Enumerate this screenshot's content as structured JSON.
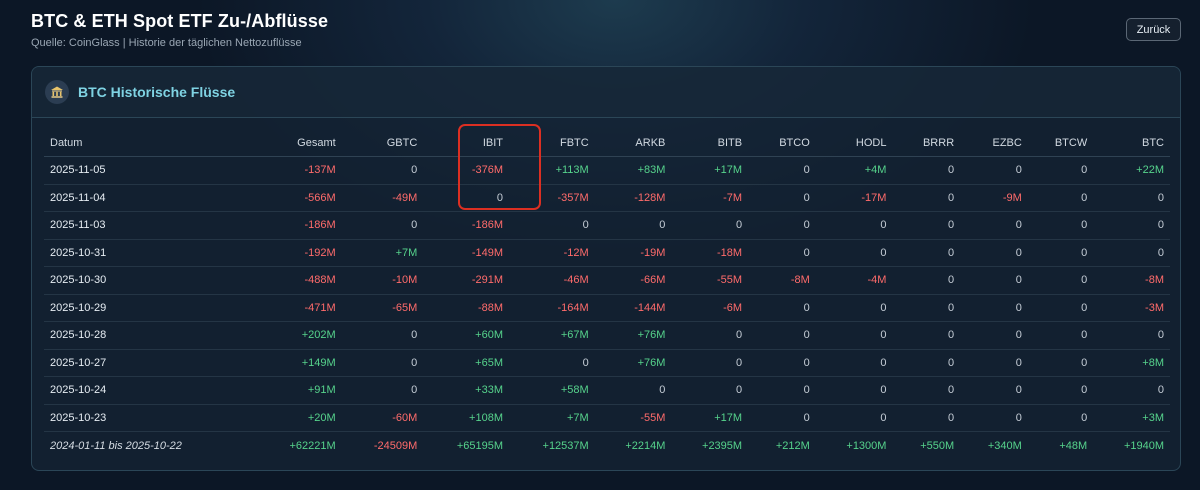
{
  "page": {
    "title": "BTC & ETH Spot ETF Zu-/Abflüsse",
    "subtitle": "Quelle: CoinGlass | Historie der täglichen Nettozuflüsse",
    "back_label": "Zurück"
  },
  "card": {
    "title": "BTC Historische Flüsse",
    "icon": "bank-icon"
  },
  "colors": {
    "positive": "#56d38c",
    "negative": "#ff6b6b",
    "accent": "#7fd3e3",
    "highlight": "#dc2f22"
  },
  "table": {
    "headers": [
      "Datum",
      "Gesamt",
      "GBTC",
      "IBIT",
      "FBTC",
      "ARKB",
      "BITB",
      "BTCO",
      "HODL",
      "BRRR",
      "EZBC",
      "BTCW",
      "BTC"
    ],
    "rows": [
      [
        "2025-11-05",
        "-137M",
        "0",
        "-376M",
        "+113M",
        "+83M",
        "+17M",
        "0",
        "+4M",
        "0",
        "0",
        "0",
        "+22M"
      ],
      [
        "2025-11-04",
        "-566M",
        "-49M",
        "0",
        "-357M",
        "-128M",
        "-7M",
        "0",
        "-17M",
        "0",
        "-9M",
        "0",
        "0"
      ],
      [
        "2025-11-03",
        "-186M",
        "0",
        "-186M",
        "0",
        "0",
        "0",
        "0",
        "0",
        "0",
        "0",
        "0",
        "0"
      ],
      [
        "2025-10-31",
        "-192M",
        "+7M",
        "-149M",
        "-12M",
        "-19M",
        "-18M",
        "0",
        "0",
        "0",
        "0",
        "0",
        "0"
      ],
      [
        "2025-10-30",
        "-488M",
        "-10M",
        "-291M",
        "-46M",
        "-66M",
        "-55M",
        "-8M",
        "-4M",
        "0",
        "0",
        "0",
        "-8M"
      ],
      [
        "2025-10-29",
        "-471M",
        "-65M",
        "-88M",
        "-164M",
        "-144M",
        "-6M",
        "0",
        "0",
        "0",
        "0",
        "0",
        "-3M"
      ],
      [
        "2025-10-28",
        "+202M",
        "0",
        "+60M",
        "+67M",
        "+76M",
        "0",
        "0",
        "0",
        "0",
        "0",
        "0",
        "0"
      ],
      [
        "2025-10-27",
        "+149M",
        "0",
        "+65M",
        "0",
        "+76M",
        "0",
        "0",
        "0",
        "0",
        "0",
        "0",
        "+8M"
      ],
      [
        "2025-10-24",
        "+91M",
        "0",
        "+33M",
        "+58M",
        "0",
        "0",
        "0",
        "0",
        "0",
        "0",
        "0",
        "0"
      ],
      [
        "2025-10-23",
        "+20M",
        "-60M",
        "+108M",
        "+7M",
        "-55M",
        "+17M",
        "0",
        "0",
        "0",
        "0",
        "0",
        "+3M"
      ]
    ],
    "total_row": [
      "2024-01-11 bis 2025-10-22",
      "+62221M",
      "-24509M",
      "+65195M",
      "+12537M",
      "+2214M",
      "+2395M",
      "+212M",
      "+1300M",
      "+550M",
      "+340M",
      "+48M",
      "+1940M"
    ]
  }
}
